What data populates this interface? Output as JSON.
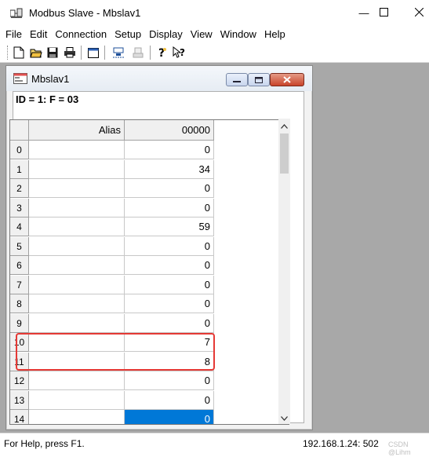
{
  "window": {
    "title": "Modbus Slave - Mbslav1",
    "icon": "modbus-app-icon",
    "minimize": "—",
    "maximize": "☐",
    "close": "✕"
  },
  "menu": [
    "File",
    "Edit",
    "Connection",
    "Setup",
    "Display",
    "View",
    "Window",
    "Help"
  ],
  "toolbar": {
    "icons": [
      "new-icon",
      "open-icon",
      "save-icon",
      "print-icon",
      "window-icon",
      "connect-icon",
      "disconnect-icon",
      "help-icon",
      "context-help-icon"
    ]
  },
  "child": {
    "title": "Mbslav1",
    "id_line": "ID = 1: F = 03",
    "grid": {
      "corner": "",
      "alias_header": "Alias",
      "column_header": "00000",
      "rows": [
        {
          "num": "0",
          "value": "0"
        },
        {
          "num": "1",
          "value": "34"
        },
        {
          "num": "2",
          "value": "0"
        },
        {
          "num": "3",
          "value": "0"
        },
        {
          "num": "4",
          "value": "59"
        },
        {
          "num": "5",
          "value": "0"
        },
        {
          "num": "6",
          "value": "0"
        },
        {
          "num": "7",
          "value": "0"
        },
        {
          "num": "8",
          "value": "0"
        },
        {
          "num": "9",
          "value": "0"
        },
        {
          "num": "10",
          "value": "7"
        },
        {
          "num": "11",
          "value": "8"
        },
        {
          "num": "12",
          "value": "0"
        },
        {
          "num": "13",
          "value": "0"
        },
        {
          "num": "14",
          "value": "0"
        }
      ],
      "selected_row": 14,
      "highlighted_rows": [
        10,
        11
      ]
    }
  },
  "status": {
    "help": "For Help, press F1.",
    "address": "192.168.1.24: 502",
    "watermark": "CSDN @Lihm"
  },
  "colors": {
    "selection": "#0078d7",
    "highlight": "#e53935",
    "mdi_background": "#a8a8a8"
  }
}
